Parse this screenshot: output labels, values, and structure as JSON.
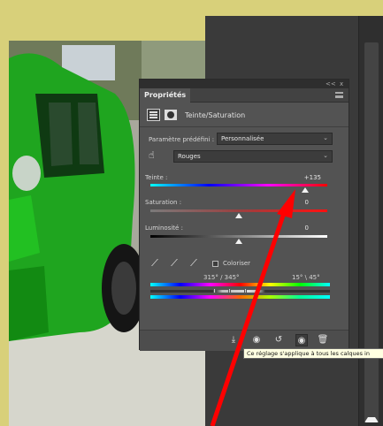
{
  "panel": {
    "tab_label": "Propriétés",
    "header_controls": [
      "<<",
      "x"
    ],
    "adjustment_title": "Teinte/Saturation",
    "preset_label": "Paramètre prédéfini :",
    "preset_value": "Personnalisée",
    "channel_value": "Rouges",
    "hue": {
      "label": "Teinte :",
      "value": "+135",
      "level": 135,
      "min": -180,
      "max": 180
    },
    "saturation": {
      "label": "Saturation :",
      "value": "0",
      "level": 0,
      "min": -100,
      "max": 100
    },
    "lightness": {
      "label": "Luminosité :",
      "value": "0",
      "level": 0,
      "min": -100,
      "max": 100
    },
    "colorize_label": "Coloriser",
    "colorize_checked": false,
    "range_left": "315° / 345°",
    "range_right": "15° \\ 45°"
  },
  "tooltip": "Ce réglage s'applique à tous les calques in",
  "colors": {
    "panel_bg": "#535353",
    "frame": "#d8d07a",
    "arrow": "#ff0000",
    "car": "#1fb21f"
  },
  "icons": {
    "adjustment": "hue-saturation-adjustment-icon",
    "mask": "layer-mask-icon",
    "on_image": "targeted-adjustment-hand-icon",
    "eyedroppers": [
      "eyedropper-icon",
      "eyedropper-plus-icon",
      "eyedropper-minus-icon"
    ],
    "footer": [
      "clip-to-layer-icon",
      "view-previous-state-icon",
      "reset-icon",
      "visibility-eye-icon",
      "trash-icon"
    ]
  }
}
